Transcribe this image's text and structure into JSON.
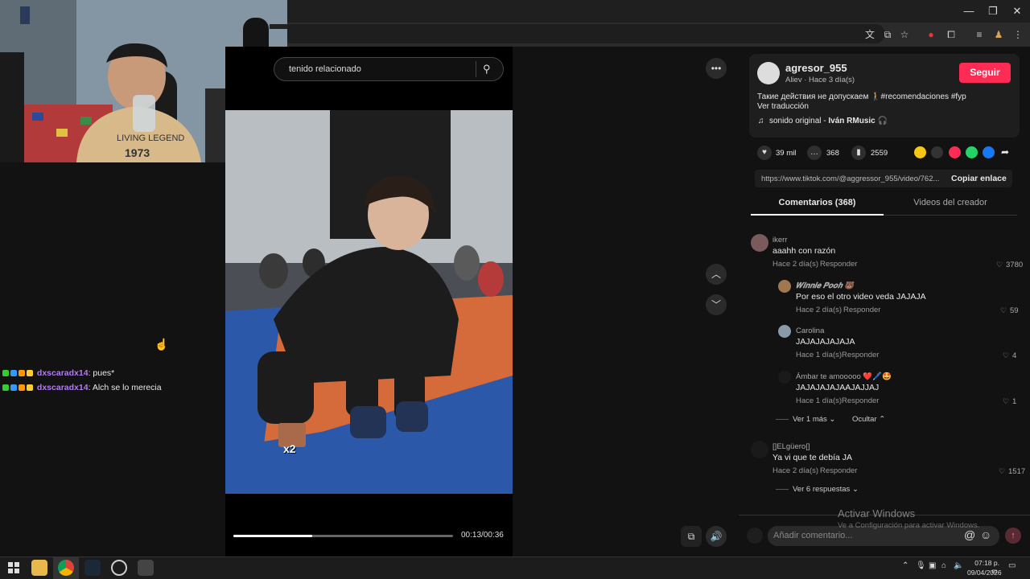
{
  "video": {
    "search_placeholder": "tenido relacionado",
    "time": "00:13/00:36",
    "progress": 0.36,
    "emote_label": "x2"
  },
  "chat": {
    "messages": [
      {
        "user": "dxscaradx14",
        "text": ": pues*"
      },
      {
        "user": "dxscaradx14",
        "text": ": Alch se lo merecia"
      }
    ]
  },
  "post": {
    "username": "agresor_955",
    "subline": "Aliev · Hace 3 día(s)",
    "follow_label": "Seguir",
    "caption": "Такие действия не допускаем 🚶#recomendaciones #fyp",
    "translate_label": "Ver traducción",
    "sound_prefix": "sonido original - ",
    "sound_artist": "Iván RMusic 🎧",
    "likes": "39 mil",
    "comments": "368",
    "saves": "2559",
    "link": "https://www.tiktok.com/@aggressor_955/video/762...",
    "copy_label": "Copiar enlace",
    "tabs": {
      "comments": "Comentarios (368)",
      "creator": "Videos del creador"
    }
  },
  "comments": [
    {
      "user": "ikerr",
      "text": "aaahh con razón",
      "meta": "Hace 2 día(s)",
      "reply": "Responder",
      "likes": "3780"
    },
    {
      "user": "𝑾𝒊𝒏𝒏𝒊𝒆 𝑷𝒐𝒐𝒉 🐻",
      "text": "Por eso el otro video veda JAJAJA",
      "meta": "Hace 2 día(s)",
      "reply": "Responder",
      "likes": "59"
    },
    {
      "user": "Carolina",
      "text": "JAJAJAJAJAJA",
      "meta": "Hace 1 día(s)",
      "reply": "Responder",
      "likes": "4"
    },
    {
      "user": "Ámbar te amooooo ❤️🖊️🤩",
      "text": "JAJAJAJAJAAJAJJAJ",
      "meta": "Hace 1 día(s)",
      "reply": "Responder",
      "likes": "1"
    },
    {
      "user": "[]ELgüero[]",
      "text": "Ya vi que te debía JA",
      "meta": "Hace 2 día(s)",
      "reply": "Responder",
      "likes": "1517"
    }
  ],
  "replies_controls": {
    "more": "Ver 1 más",
    "hide": "Ocultar",
    "more6": "Ver 6 respuestas"
  },
  "comment_input_placeholder": "Añadir comentario...",
  "watermark": {
    "title": "Activar Windows",
    "subtitle": "Ve a Configuración para activar Windows."
  },
  "taskbar": {
    "time": "07:18 p. m.",
    "date": "09/04/2026"
  },
  "colors": {
    "accent": "#fe2c55",
    "chat_user": "#b07cf0"
  }
}
